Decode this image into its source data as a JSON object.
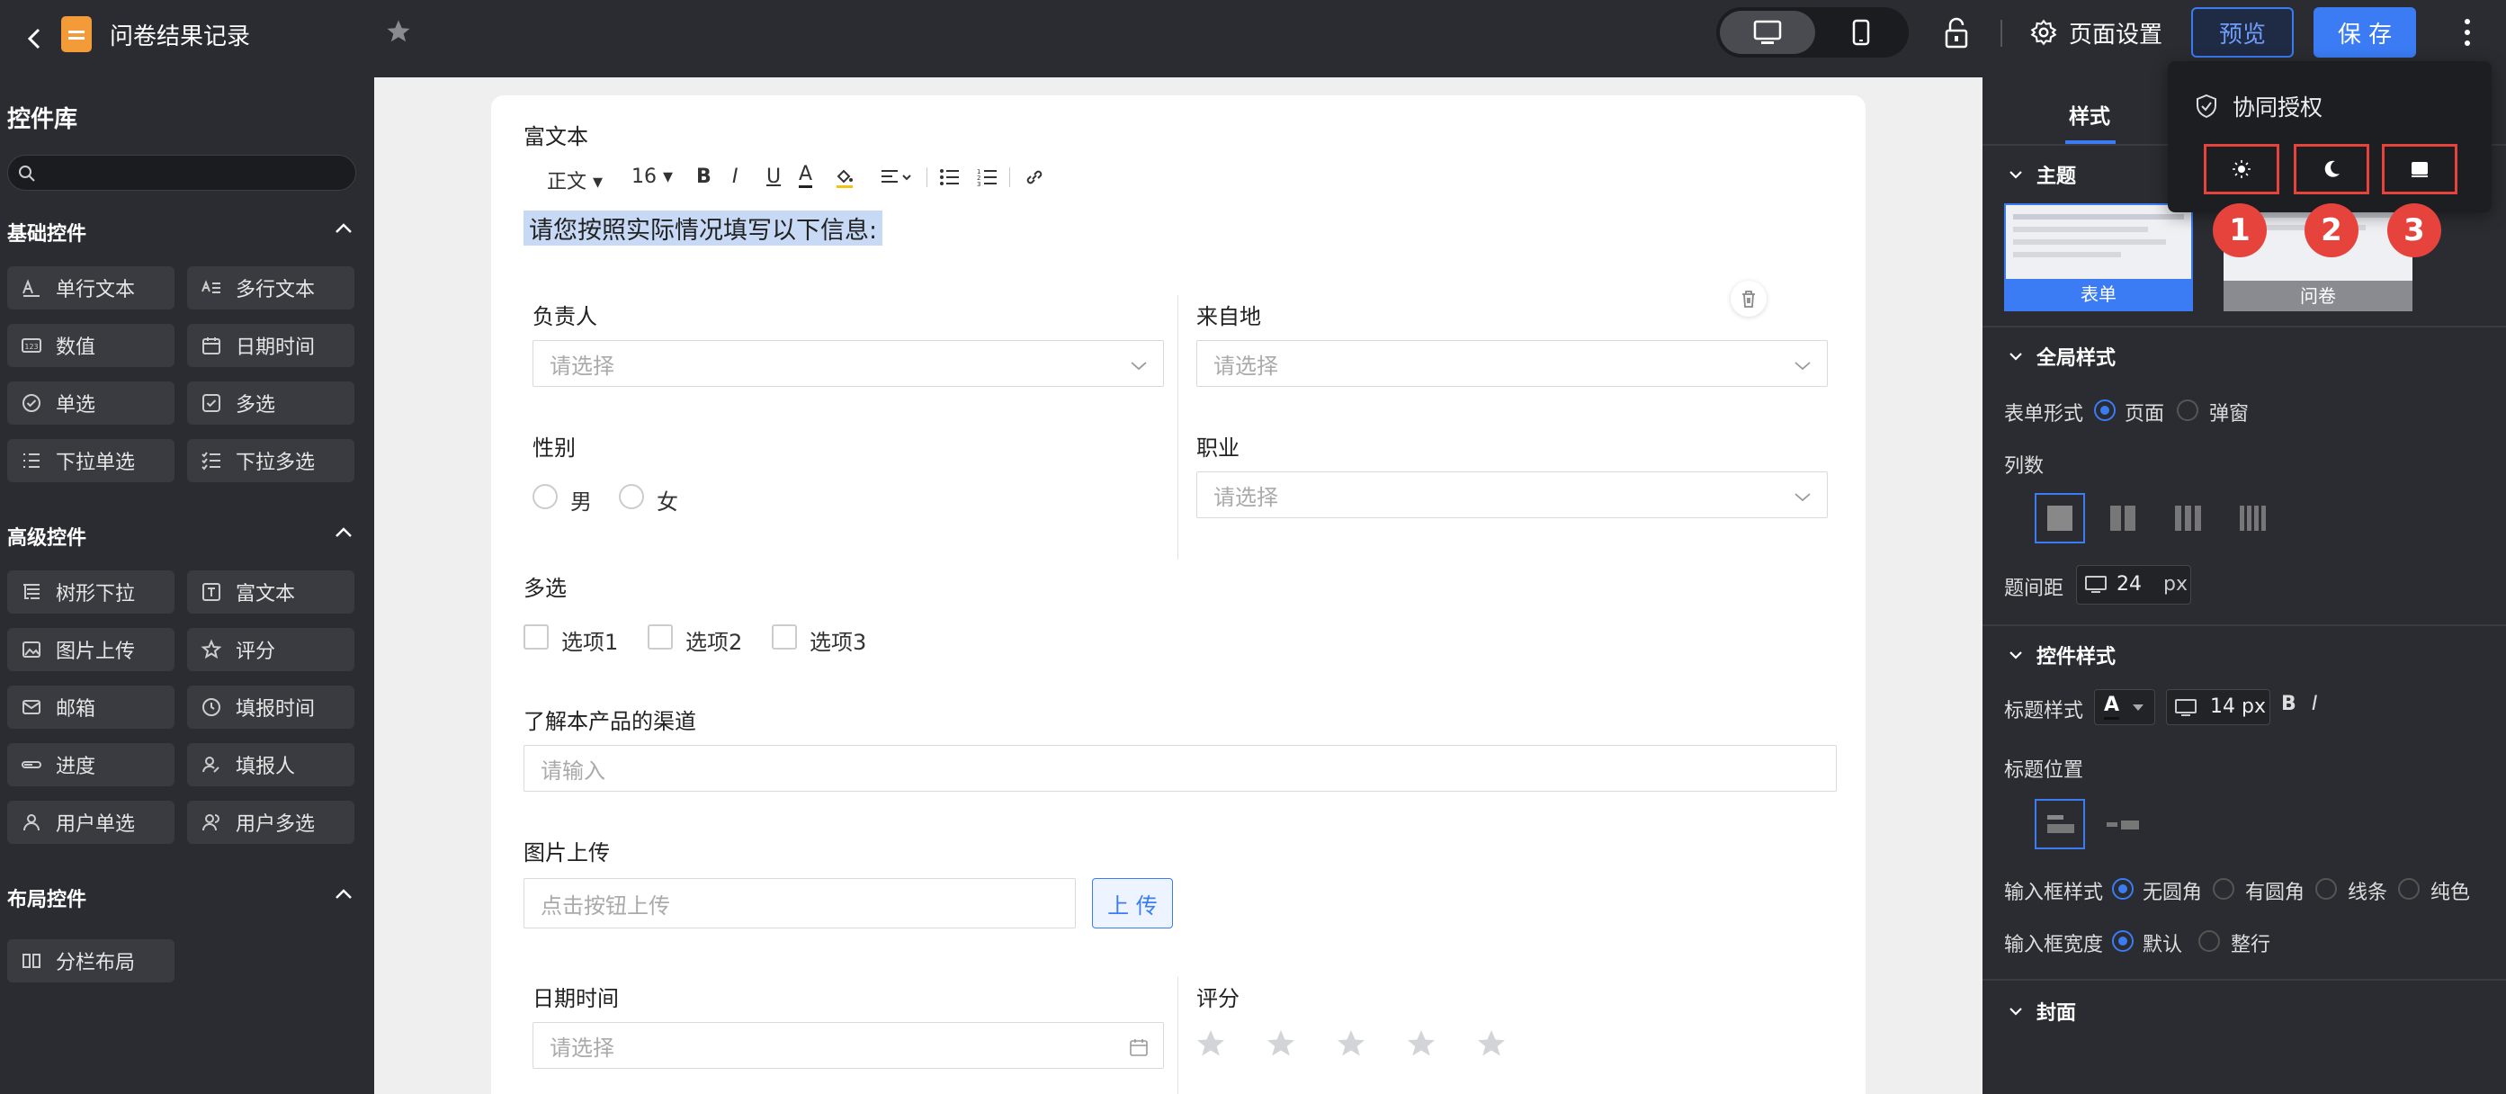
{
  "header": {
    "title": "问卷结果记录",
    "page_settings": "页面设置",
    "preview": "预览",
    "save": "保 存"
  },
  "sidebar": {
    "title": "控件库",
    "search_placeholder": "",
    "basic": {
      "title": "基础控件",
      "items": [
        "单行文本",
        "多行文本",
        "数值",
        "日期时间",
        "单选",
        "多选",
        "下拉单选",
        "下拉多选"
      ]
    },
    "advanced": {
      "title": "高级控件",
      "items": [
        "树形下拉",
        "富文本",
        "图片上传",
        "评分",
        "邮箱",
        "填报时间",
        "进度",
        "填报人",
        "用户单选",
        "用户多选"
      ]
    },
    "layout": {
      "title": "布局控件",
      "items": [
        "分栏布局"
      ]
    }
  },
  "form": {
    "rich_text_label": "富文本",
    "toolbar": {
      "style": "正文",
      "size": "16"
    },
    "intro": "请您按照实际情况填写以下信息:",
    "owner_label": "负责人",
    "origin_label": "来自地",
    "gender_label": "性别",
    "gender_options": [
      "男",
      "女"
    ],
    "job_label": "职业",
    "select_placeholder": "请选择",
    "multi_label": "多选",
    "multi_options": [
      "选项1",
      "选项2",
      "选项3"
    ],
    "channel_label": "了解本产品的渠道",
    "input_placeholder": "请输入",
    "upload_label": "图片上传",
    "upload_placeholder": "点击按钮上传",
    "upload_button": "上 传",
    "date_label": "日期时间",
    "rating_label": "评分",
    "rating_stars": 5
  },
  "popup": {
    "title": "协同授权",
    "badges": [
      "1",
      "2",
      "3"
    ]
  },
  "right_panel": {
    "tab_style": "样式",
    "theme_section": "主题",
    "theme_cards": [
      "表单",
      "问卷"
    ],
    "global_section": "全局样式",
    "form_mode_label": "表单形式",
    "form_mode_options": [
      "页面",
      "弹窗"
    ],
    "columns_label": "列数",
    "spacing_label": "题间距",
    "spacing_value": "24",
    "unit_px": "px",
    "control_section": "控件样式",
    "title_style_label": "标题样式",
    "font_letter": "A",
    "title_size": "14 px",
    "bold": "B",
    "italic": "I",
    "title_pos_label": "标题位置",
    "input_style_label": "输入框样式",
    "input_style_options": [
      "无圆角",
      "有圆角",
      "线条",
      "纯色"
    ],
    "input_width_label": "输入框宽度",
    "input_width_options": [
      "默认",
      "整行"
    ],
    "cover_section": "封面"
  },
  "colors": {
    "accent": "#3b7cf4",
    "dark_bg": "#2b2c31",
    "annotation": "#e5433b"
  }
}
